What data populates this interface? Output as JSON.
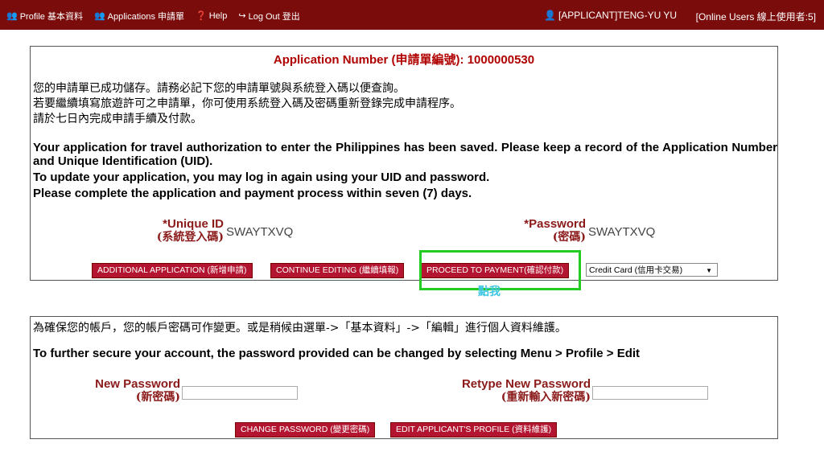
{
  "topbar": {
    "menu": [
      {
        "label": "Profile 基本資料"
      },
      {
        "label": "Applications 申請單"
      },
      {
        "label": "Help"
      },
      {
        "label": "Log Out 登出"
      }
    ],
    "user": "[APPLICANT]TENG-YU YU",
    "online": "[Online Users 線上使用者:5]"
  },
  "app": {
    "title": "Application Number (申請單編號): 1000000530",
    "zh_lines": [
      "您的申請單已成功儲存。請務必記下您的申請單號與系統登入碼以便查詢。",
      "若要繼續填寫旅遊許可之申請單，你可使用系統登入碼及密碼重新登錄完成申請程序。",
      "請於七日內完成申請手續及付款。"
    ],
    "en_text": "Your application for travel authorization to enter the Philippines has been saved. Please keep a record of the Application Number and Unique Identification (UID).",
    "en_line2": "To update your application, you may log in again using your UID and password.",
    "en_line3": "Please complete the application and payment process within seven (7) days.",
    "uid_label": "*Unique ID",
    "uid_label_zh": "(系統登入碼)",
    "uid_value": "SWAYTXVQ",
    "pw_label": "*Password",
    "pw_label_zh": "(密碼)",
    "pw_value": "SWAYTXVQ",
    "btn_additional": "ADDITIONAL APPLICATION (新增申請)",
    "btn_continue": "CONTINUE EDITING (繼續填報)",
    "btn_proceed": "PROCEED TO PAYMENT(確認付款)",
    "payment_select": "Credit Card (信用卡交易)",
    "click_hint": "點我"
  },
  "account": {
    "zh_text": "為確保您的帳戶，您的帳戶密碼可作變更。或是稍候由選單->「基本資料」->「編輯」進行個人資料維護。",
    "en_text": "To further secure your account, the password provided can be changed by selecting Menu > Profile > Edit",
    "new_pw_label": "New Password",
    "new_pw_label_zh": "(新密碼)",
    "retype_label": "Retype New Password",
    "retype_label_zh": "(重新輸入新密碼)",
    "btn_change": "CHANGE PASSWORD (變更密碼)",
    "btn_edit": "EDIT APPLICANT'S PROFILE (資料維護)"
  }
}
